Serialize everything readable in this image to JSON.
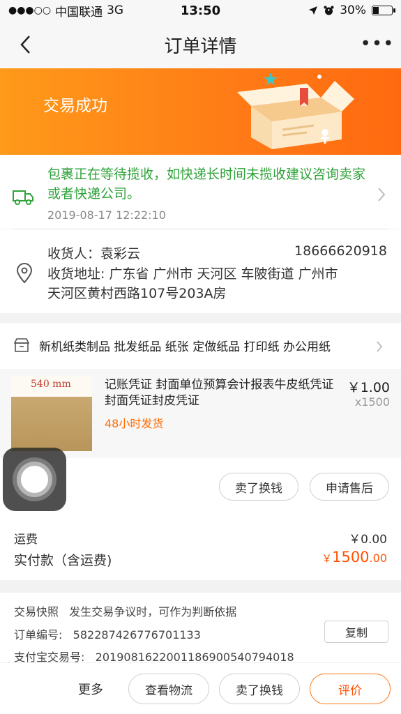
{
  "status_bar": {
    "carrier": "中国联通",
    "network": "3G",
    "time": "13:50",
    "battery": "30%"
  },
  "nav": {
    "title": "订单详情",
    "more": "•••"
  },
  "banner": {
    "title": "交易成功"
  },
  "logistics": {
    "message": "包裹正在等待揽收，如快递长时间未揽收建议咨询卖家或者快递公司。",
    "time": "2019-08-17 12:22:10"
  },
  "address": {
    "name": "收货人：袁彩云",
    "phone": "18666620918",
    "line1": "收货地址: 广东省 广州市 天河区  车陂街道 广州市",
    "line2": "天河区黄村西路107号203A房"
  },
  "shop": {
    "name": "新机纸类制品 批发纸品 纸张 定做纸品 打印纸 办公用纸"
  },
  "product": {
    "image_text": "540 mm",
    "title": "记账凭证 封面单位预算会计报表牛皮纸凭证封面凭证封皮凭证",
    "price": "￥1.00",
    "qty": "x1500",
    "shipping": "48小时发货",
    "sell_button": "卖了换钱",
    "refund_button": "申请售后"
  },
  "fees": {
    "shipping_label": "运费",
    "shipping_value": "￥0.00",
    "paid_label": "实付款（含运费)",
    "paid_currency": "￥",
    "paid_int": "1500",
    "paid_dec": ".00"
  },
  "order_info": {
    "snapshot_label": "交易快照",
    "snapshot_text": "发生交易争议时，可作为判断依据",
    "order_no_label": "订单编号:",
    "order_no": "582287426776701133",
    "copy_button": "复制",
    "alipay_label": "支付宝交易号:",
    "alipay_no": "2019081622001186900540794018"
  },
  "bottom_bar": {
    "more": "更多",
    "logistics_button": "查看物流",
    "sell_button": "卖了换钱",
    "rate_button": "评价"
  },
  "colors": {
    "banner": "#ff7a16",
    "logistics_green": "#2fa33a",
    "price_orange": "#ff5000"
  }
}
